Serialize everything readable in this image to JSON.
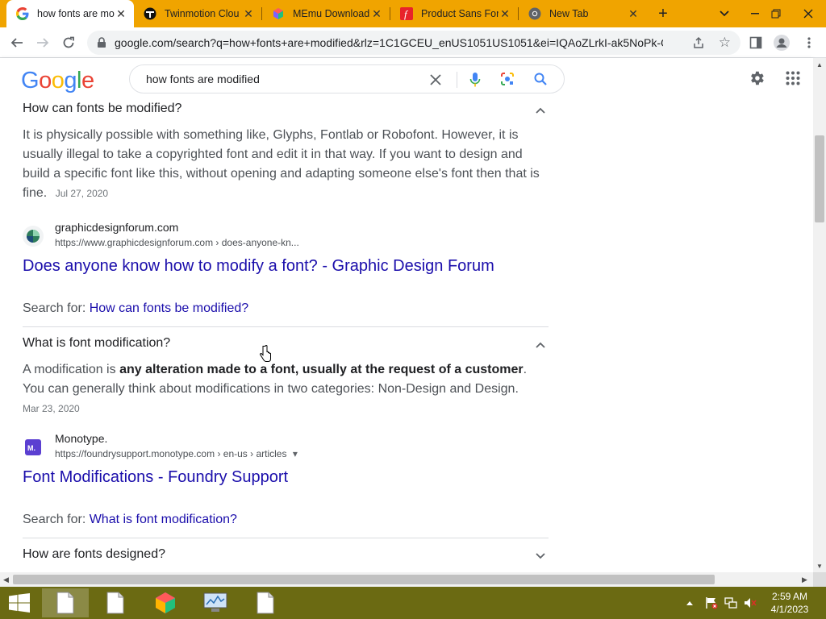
{
  "browser": {
    "tabs": [
      {
        "title": "how fonts are mo",
        "active": true,
        "icon": "google-g-icon"
      },
      {
        "title": "Twinmotion Clou",
        "active": false,
        "icon": "twinmotion-icon"
      },
      {
        "title": "MEmu Download",
        "active": false,
        "icon": "memu-icon"
      },
      {
        "title": "Product Sans For",
        "active": false,
        "icon": "fontsmith-icon"
      },
      {
        "title": "New Tab",
        "active": false,
        "icon": "chrome-icon"
      }
    ],
    "url": "google.com/search?q=how+fonts+are+modified&rlz=1C1GCEU_enUS1051US1051&ei=IQAoZLrkI-ak5NoPk-GLi...",
    "accent": "#f0a400"
  },
  "google": {
    "logo": "Google",
    "query": "how fonts are modified"
  },
  "results": {
    "q1": {
      "question": "How can fonts be modified?",
      "answer": "It is physically possible with something like, Glyphs, Fontlab or Robofont. However, it is usually illegal to take a copyrighted font and edit it in that way. If you want to design and build a specific font like this, without opening and adapting someone else's font then that is fine.",
      "date": "Jul 27, 2020",
      "site_name": "graphicdesignforum.com",
      "site_url": "https://www.graphicdesignforum.com › does-anyone-kn...",
      "link": "Does anyone know how to modify a font? - Graphic Design Forum",
      "search_for_label": "Search for: ",
      "search_for_link": "How can fonts be modified?"
    },
    "q2": {
      "question": "What is font modification?",
      "answer_pre": "A modification is ",
      "answer_bold": "any alteration made to a font, usually at the request of a customer",
      "answer_post": ". You can generally think about modifications in two categories: Non-Design and Design.",
      "date": "Mar 23, 2020",
      "site_name": "Monotype.",
      "site_url": "https://foundrysupport.monotype.com › en-us › articles",
      "link": "Font Modifications - Foundry Support",
      "search_for_label": "Search for: ",
      "search_for_link": "What is font modification?"
    },
    "q3": {
      "question": "How are fonts designed?"
    }
  },
  "taskbar": {
    "time": "2:59 AM",
    "date": "4/1/2023"
  }
}
